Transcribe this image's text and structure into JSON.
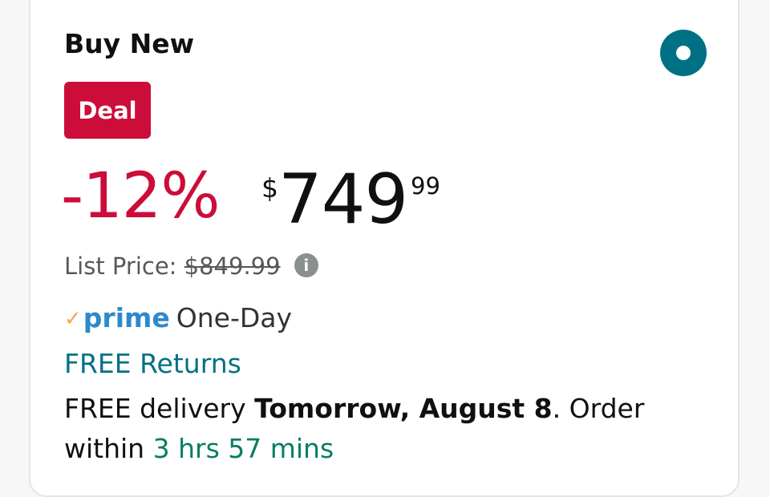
{
  "card": {
    "title": "Buy New",
    "radio": {
      "selected": true,
      "color": "#007185"
    },
    "badge": {
      "label": "Deal",
      "color": "#cc0c39"
    },
    "price": {
      "discount": "-12%",
      "currency": "$",
      "whole": "749",
      "fraction": "99"
    },
    "list_price": {
      "label": "List Price:",
      "value": "$849.99",
      "icon": "info-icon"
    },
    "prime": {
      "check": "✓",
      "brand": "prime",
      "speed": "One-Day"
    },
    "returns": "FREE Returns",
    "delivery": {
      "prefix": "FREE delivery",
      "date": "Tomorrow, August 8",
      "order_text": ". Order within",
      "countdown": "3 hrs 57 mins"
    }
  }
}
